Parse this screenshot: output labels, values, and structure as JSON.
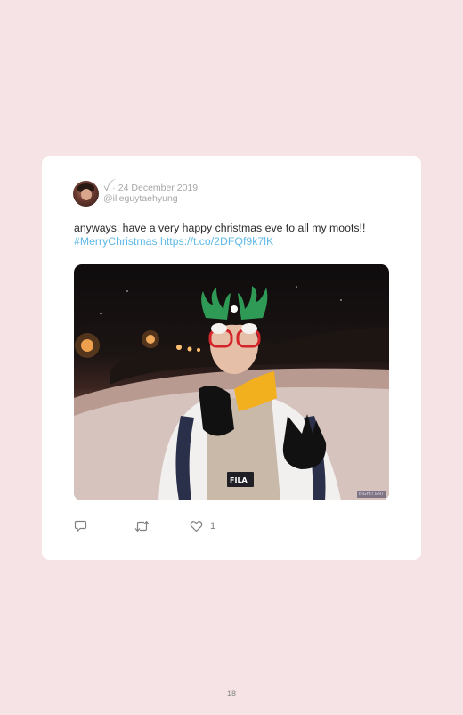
{
  "tweet": {
    "display_name": "ꪜ",
    "separator": "·",
    "date": "24 December 2019",
    "handle": "@illeguytaehyung",
    "text": "anyways, have a very happy christmas eve to all my moots!!",
    "hashtag": "#MerryChristmas",
    "link": "https://t.co/2DFQf9k7lK",
    "photo_credit": "BIGHIT ENT",
    "likes": "1"
  },
  "icons": {
    "reply": "reply-icon",
    "retweet": "retweet-icon",
    "like": "heart-icon"
  },
  "page_number": "18",
  "colors": {
    "background": "#f5e3e5",
    "card": "#ffffff",
    "link": "#5fb9e6",
    "meta": "#a7a7a7"
  }
}
